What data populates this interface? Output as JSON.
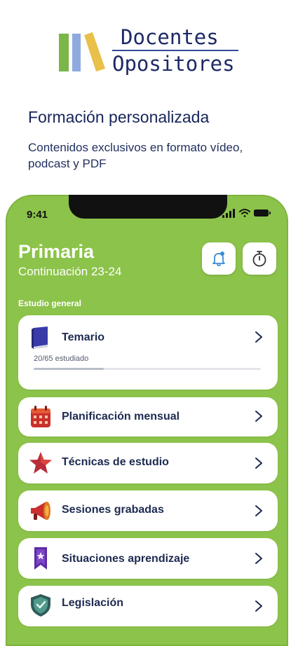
{
  "brand": {
    "line1": "Docentes",
    "line2": "Opositores",
    "colors": {
      "green": "#7ab648",
      "blue": "#8eaadf",
      "yellow": "#e8c04a"
    }
  },
  "promo": {
    "headline": "Formación personalizada",
    "subline": "Contenidos exclusivos en formato vídeo, podcast y PDF"
  },
  "phone": {
    "status": {
      "time": "9:41",
      "icons": [
        "signal-icon",
        "wifi-icon",
        "battery-icon"
      ]
    },
    "header": {
      "title": "Primaria",
      "subtitle": "Continuación 23-24",
      "notification_icon": "bell-icon",
      "timer_icon": "stopwatch-icon"
    },
    "section_label": "Estudio general",
    "temario": {
      "label": "Temario",
      "icon": "book-icon",
      "progress_text": "20/65 estudiado",
      "progress": 0.3077
    },
    "menu": [
      {
        "label": "Planificación mensual",
        "icon": "calendar-icon"
      },
      {
        "label": "Técnicas de estudio",
        "icon": "star-icon"
      },
      {
        "label": "Sesiones grabadas",
        "icon": "megaphone-icon"
      },
      {
        "label": "Situaciones aprendizaje",
        "icon": "bookmark-icon"
      },
      {
        "label": "Legislación",
        "icon": "shield-icon"
      }
    ],
    "background_color": "#8cc34a"
  }
}
